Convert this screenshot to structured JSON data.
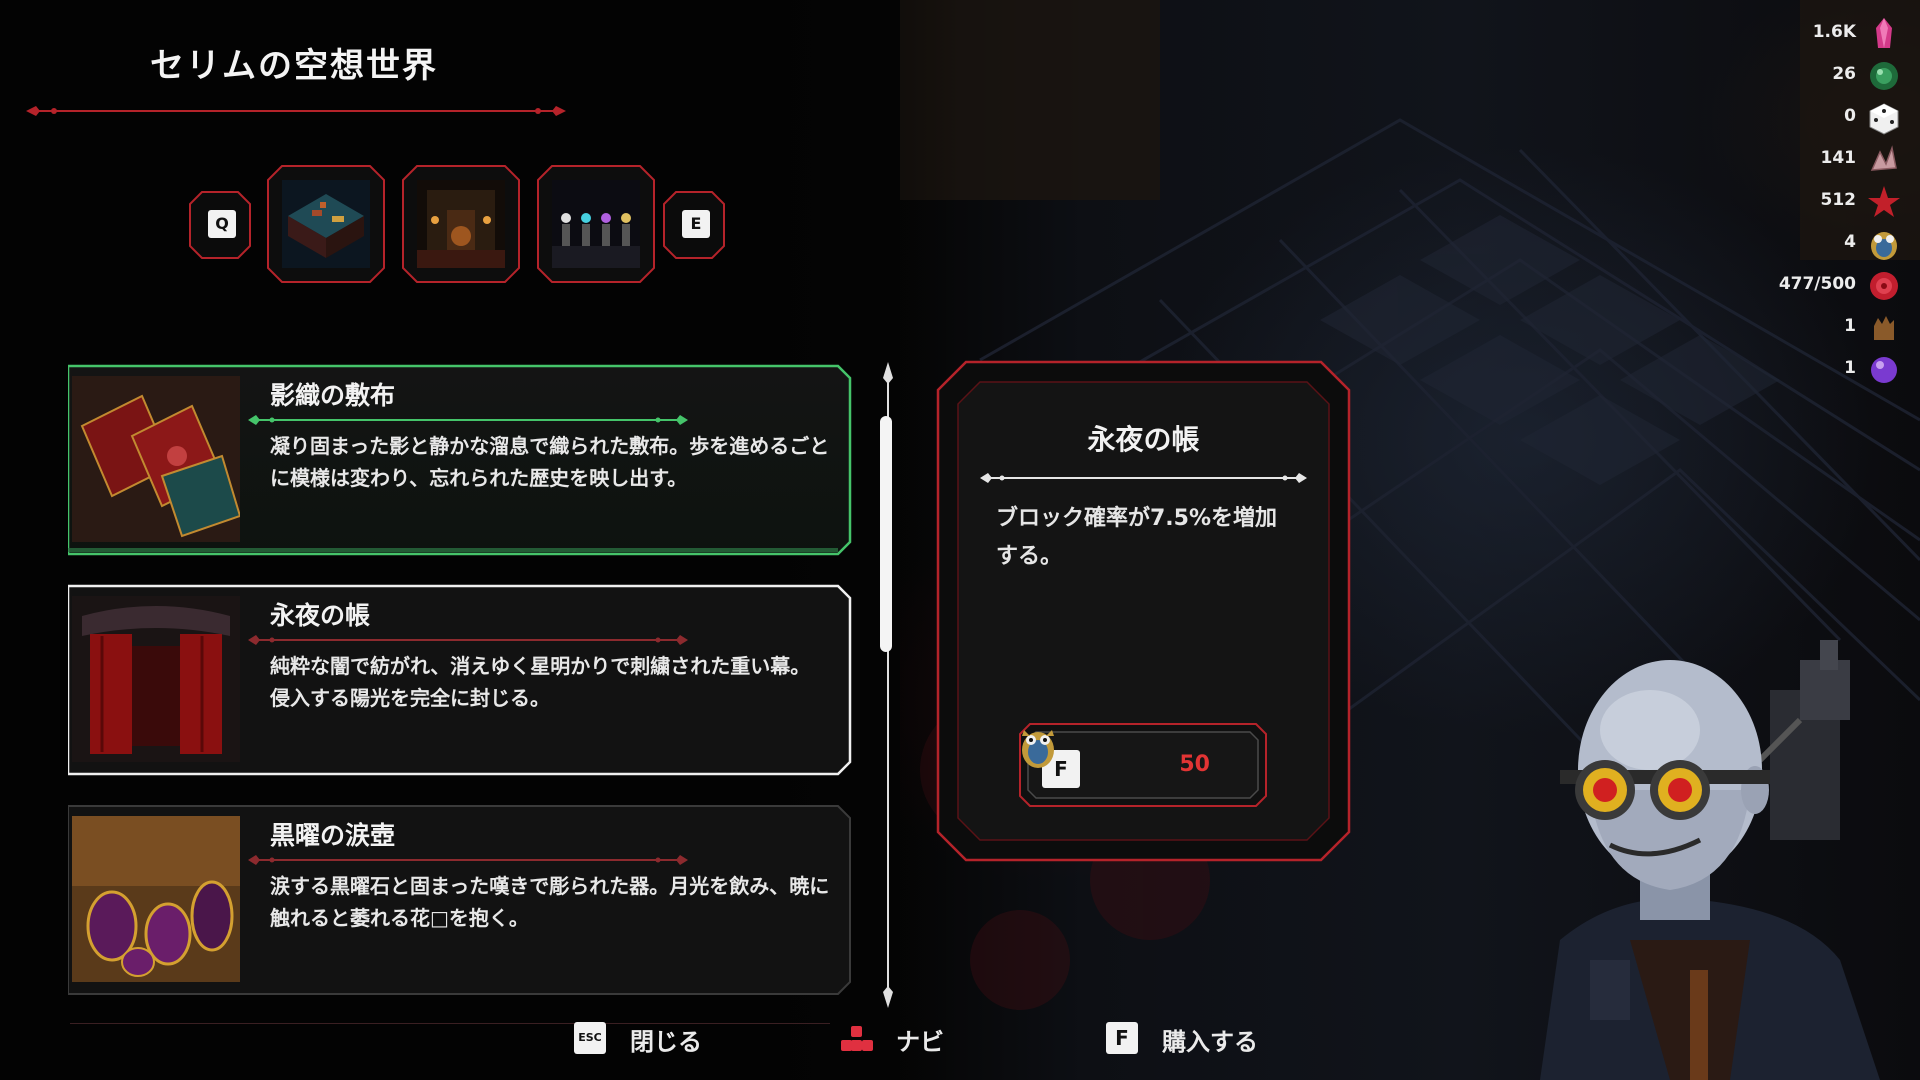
{
  "title": "セリムの空想世界",
  "category_tabs": {
    "prev_key": "Q",
    "next_key": "E",
    "tabs": [
      {
        "name": "isometric-room"
      },
      {
        "name": "candle-chamber"
      },
      {
        "name": "crystal-pedestals"
      }
    ]
  },
  "items": [
    {
      "name": "影織の敷布",
      "description": "凝り固まった影と静かな溜息で織られた敷布。歩を進めるごとに模様は変わり、忘れられた歴史を映し出す。",
      "state": "hovered"
    },
    {
      "name": "永夜の帳",
      "description": "純粋な闇で紡がれ、消えゆく星明かりで刺繍された重い幕。侵入する陽光を完全に封じる。",
      "state": "selected"
    },
    {
      "name": "黒曜の涙壺",
      "description": "涙する黒曜石と固まった嘆きで彫られた器。月光を飲み、暁に触れると萎れる花□を抱く。",
      "state": "normal"
    }
  ],
  "detail": {
    "title": "永夜の帳",
    "description": "ブロック確率が7.5%を増加する。",
    "buy_key": "F",
    "price": "50",
    "price_icon": "owl-token-icon"
  },
  "resources": [
    {
      "value": "1.6K",
      "icon": "pink-crystal-icon"
    },
    {
      "value": "26",
      "icon": "green-orb-icon"
    },
    {
      "value": "0",
      "icon": "dice-icon"
    },
    {
      "value": "141",
      "icon": "bone-shard-icon"
    },
    {
      "value": "512",
      "icon": "red-star-icon"
    },
    {
      "value": "4",
      "icon": "owl-token-icon"
    },
    {
      "value": "477/500",
      "icon": "red-rose-icon"
    },
    {
      "value": "1",
      "icon": "brown-hand-icon"
    },
    {
      "value": "1",
      "icon": "purple-sphere-icon"
    }
  ],
  "hints": {
    "close_key": "ESC",
    "close_label": "閉じる",
    "navi_label": "ナビ",
    "buy_key": "F",
    "buy_label": "購入する"
  },
  "colors": {
    "frame_red": "#b5232a",
    "hover_green": "#45c46a",
    "selected_white": "#f0f0f0",
    "price_red": "#e23434"
  }
}
